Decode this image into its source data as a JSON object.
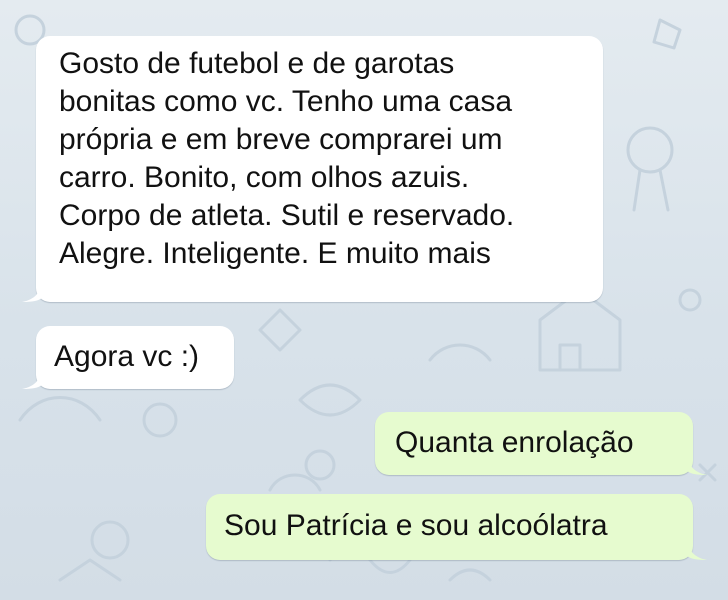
{
  "messages": [
    {
      "direction": "incoming",
      "text": "Gosto de futebol e de garotas\nbonitas como vc. Tenho uma casa\nprópria e em breve comprarei um\ncarro. Bonito, com olhos azuis.\nCorpo de atleta. Sutil e reservado.\nAlegre. Inteligente. E muito mais"
    },
    {
      "direction": "incoming",
      "text": "Agora vc :)"
    },
    {
      "direction": "outgoing",
      "text": "Quanta enrolação"
    },
    {
      "direction": "outgoing",
      "text": "Sou Patrícia e sou alcoólatra"
    }
  ],
  "colors": {
    "incoming_bubble": "#ffffff",
    "outgoing_bubble": "#e6fbcf",
    "chat_background": "#dce5ec",
    "doodle_stroke": "#c5d2dd"
  }
}
